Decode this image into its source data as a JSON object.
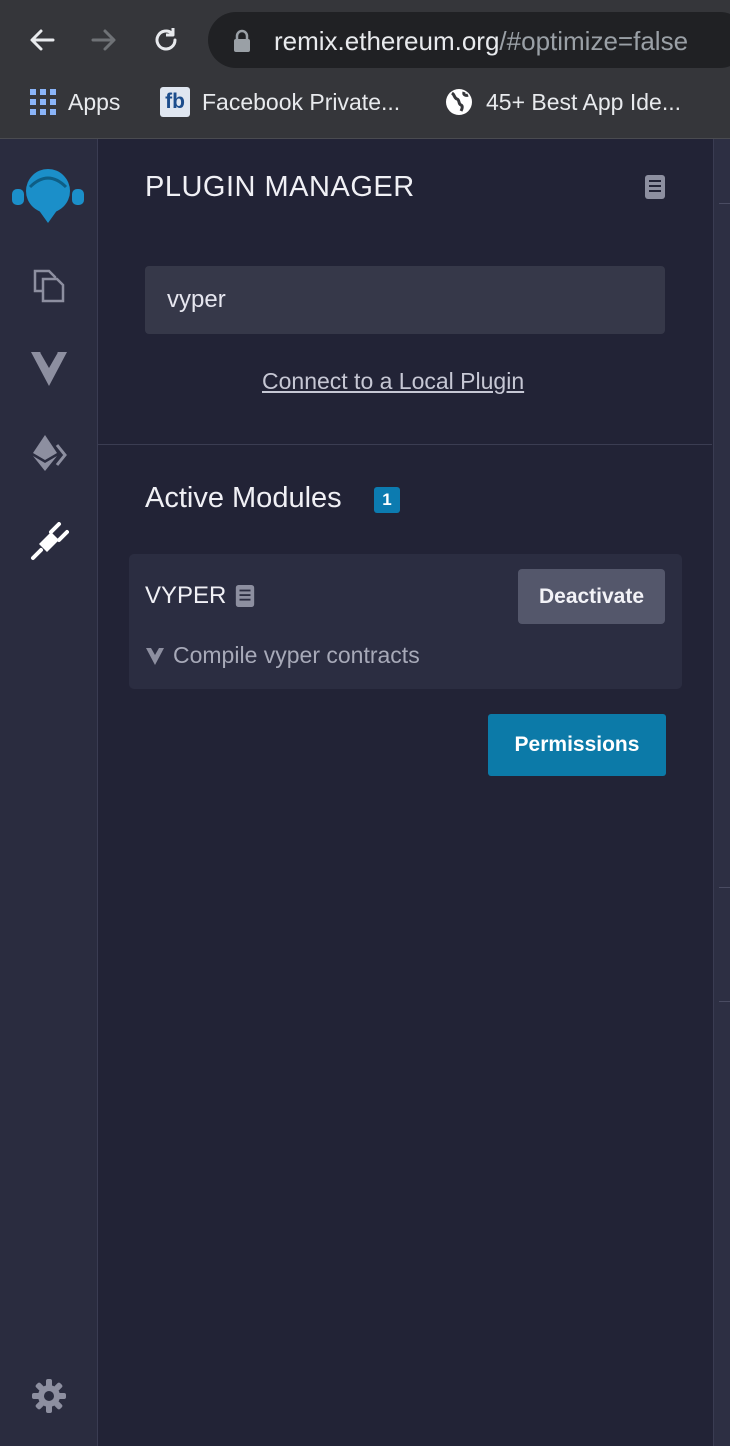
{
  "browser": {
    "url_host": "remix.ethereum.org",
    "url_rest": "/#optimize=false",
    "bookmarks": [
      {
        "label": "Apps",
        "icon": "apps-grid-icon"
      },
      {
        "label": "Facebook Private...",
        "icon": "fb-icon",
        "badge": "fb"
      },
      {
        "label": "45+ Best App Ide...",
        "icon": "globe-icon"
      }
    ]
  },
  "sidebar": {
    "items": [
      {
        "name": "remix-logo",
        "icon": "remix-logo-icon"
      },
      {
        "name": "file-explorer",
        "icon": "files-icon"
      },
      {
        "name": "vyper-compiler",
        "icon": "vyper-icon"
      },
      {
        "name": "deploy-run",
        "icon": "ethereum-icon"
      },
      {
        "name": "plugin-manager",
        "icon": "plug-icon",
        "active": true
      },
      {
        "name": "settings",
        "icon": "gear-icon"
      }
    ]
  },
  "panel": {
    "title": "PLUGIN MANAGER",
    "search": {
      "value": "vyper"
    },
    "local_plugin_link": "Connect to a Local Plugin",
    "active_section": {
      "title": "Active Modules",
      "count": "1"
    },
    "modules": [
      {
        "name": "VYPER",
        "description": "Compile vyper contracts",
        "action_label": "Deactivate"
      }
    ],
    "permissions_label": "Permissions"
  },
  "colors": {
    "accent": "#0c7aa8",
    "badge": "#0c7bb0",
    "panel_bg": "#222336",
    "sidebar_bg": "#2a2c3f",
    "card_bg": "#2b2d41"
  }
}
